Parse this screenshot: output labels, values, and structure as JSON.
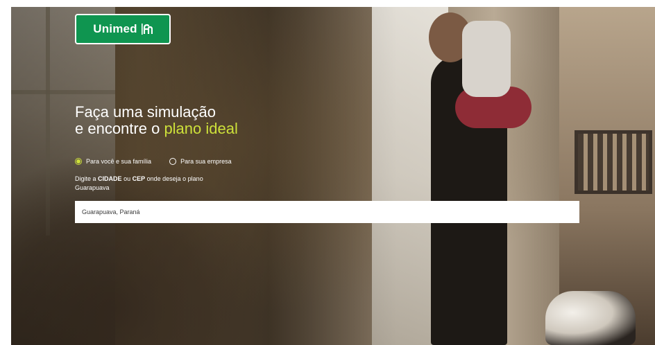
{
  "brand": {
    "name": "Unimed",
    "color": "#0f9550"
  },
  "hero": {
    "title_line1": "Faça uma simulação",
    "title_line2_prefix": "e encontre o",
    "title_line2_highlight": "plano ideal",
    "highlight_color": "#cde03a"
  },
  "plan_type": {
    "options": [
      {
        "label": "Para você e sua família",
        "selected": true
      },
      {
        "label": "Para sua empresa",
        "selected": false
      }
    ]
  },
  "location": {
    "helper_prefix": "Digite a",
    "helper_city": "CIDADE",
    "helper_or": "ou",
    "helper_cep": "CEP",
    "helper_suffix": "onde deseja o plano",
    "detected_city": "Guarapuava",
    "input_value": "Guarapuava, Paraná"
  }
}
